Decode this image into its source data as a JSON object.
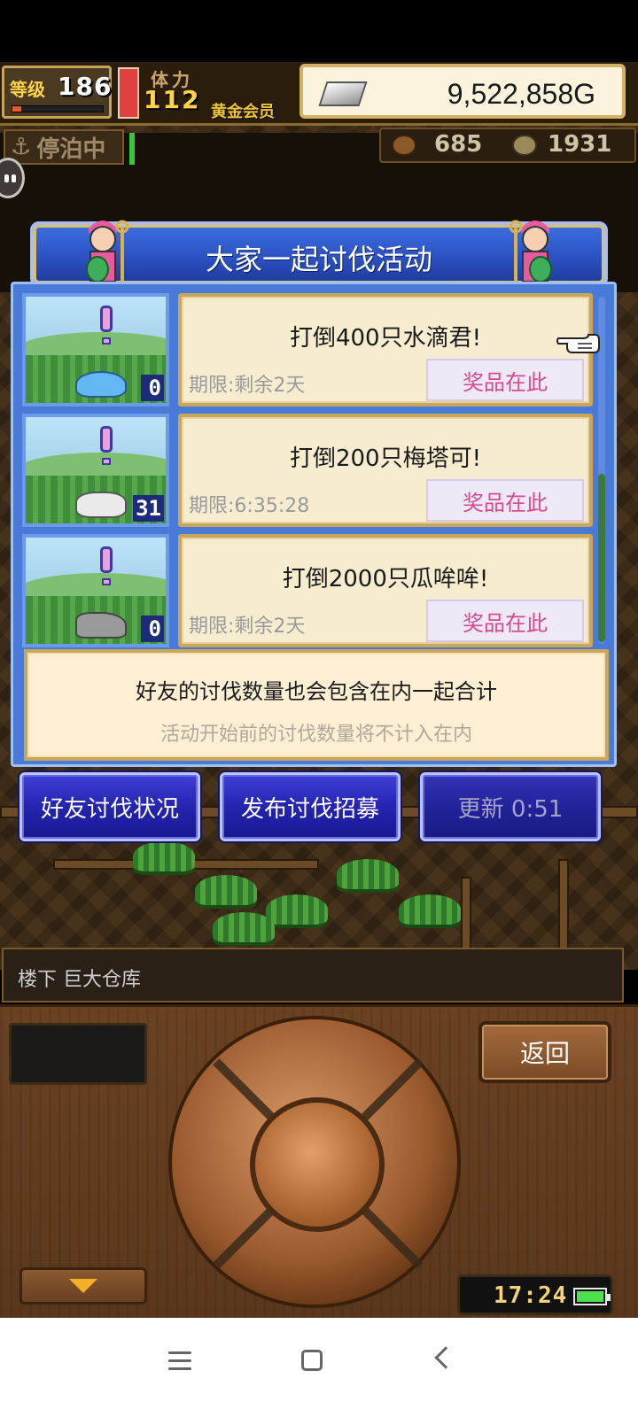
{
  "hud": {
    "level_label": "等级",
    "level_value": "186",
    "exp_fraction": 0.1,
    "stamina_label": "体力",
    "stamina_value": "112",
    "stamina_fraction": 1.0,
    "member_label": "黄金会员",
    "gold_value": "9,522,858G",
    "dock_status": "停泊中",
    "resource_1": "685",
    "resource_2": "1931"
  },
  "event": {
    "title": "大家一起讨伐活动",
    "items": [
      {
        "name": "打倒400只水滴君!",
        "deadline": "期限:剩余2天",
        "count": "0",
        "prize_label": "奖品在此",
        "monster": "slime"
      },
      {
        "name": "打倒200只梅塔可!",
        "deadline": "期限:6:35:28",
        "count": "31",
        "prize_label": "奖品在此",
        "monster": "cat"
      },
      {
        "name": "打倒2000只瓜哞哞!",
        "deadline": "期限:剩余2天",
        "count": "0",
        "prize_label": "奖品在此",
        "monster": "wolf"
      }
    ],
    "info_main": "好友的讨伐数量也会包含在内一起合计",
    "info_sub": "活动开始前的讨伐数量将不计入在内"
  },
  "actions": {
    "friends_status": "好友讨伐状况",
    "post_recruit": "发布讨伐招募",
    "refresh": "更新 0:51"
  },
  "location": "楼下 巨大仓库",
  "controller": {
    "back_label": "返回",
    "clock": "17:24"
  },
  "colors": {
    "panel_blue": "#4a7ad8",
    "prize_pink": "#d74a8e",
    "card_cream": "#f8ecd0"
  },
  "icons": [
    "anchor-icon",
    "ingot-icon",
    "chat-bubble-icon",
    "hand-pointer-icon",
    "battery-icon",
    "down-arrow-icon",
    "nav-menu-icon",
    "nav-home-icon",
    "nav-back-icon"
  ]
}
